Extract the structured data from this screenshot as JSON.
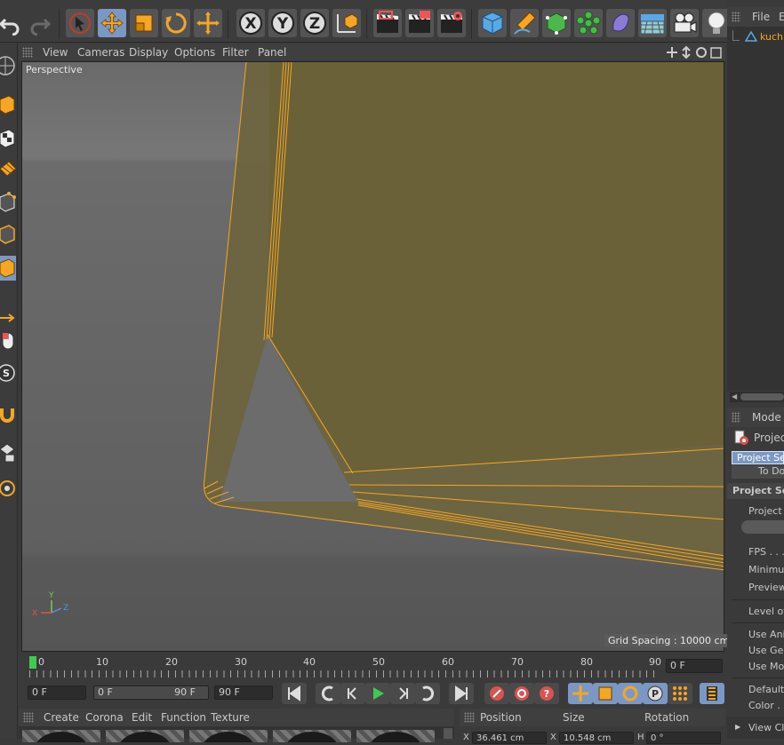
{
  "viewport": {
    "menu": [
      "View",
      "Cameras",
      "Display",
      "Options",
      "Filter",
      "Panel"
    ],
    "camera_label": "Perspective",
    "grid_spacing": "Grid Spacing : 10000 cm",
    "axis": {
      "x": "X",
      "y": "Y",
      "z": "Z"
    }
  },
  "toolbar": {
    "icons": [
      "undo-icon",
      "redo-icon",
      "select-icon",
      "move-icon",
      "scale-icon",
      "rotate-icon",
      "transform-icon",
      "x-axis-icon",
      "y-axis-icon",
      "z-axis-icon",
      "coordinate-system-icon",
      "render-view-icon",
      "render-picture-viewer-icon",
      "render-settings-icon",
      "cube-icon",
      "pen-icon",
      "subdivision-icon",
      "cloner-icon",
      "deformer-icon",
      "floor-icon",
      "camera-icon",
      "light-icon"
    ],
    "axis_labels": [
      "X",
      "Y",
      "Z"
    ]
  },
  "timeline": {
    "ticks": [
      "0",
      "10",
      "20",
      "30",
      "40",
      "50",
      "60",
      "70",
      "80",
      "90"
    ],
    "current_frame": "0 F",
    "start": "0 F",
    "range_start": "0 F",
    "range_end": "90 F",
    "end": "90 F"
  },
  "materials": {
    "menu": [
      "Create",
      "Corona",
      "Edit",
      "Function",
      "Texture"
    ]
  },
  "coordinates": {
    "headers": [
      "Position",
      "Size",
      "Rotation"
    ],
    "x_label": "X",
    "x_value": "36.461 cm",
    "size_label": "X",
    "size_value": "10.548 cm",
    "rot_label": "H",
    "rot_value": "0 °"
  },
  "object_manager": {
    "menu": [
      "File",
      "E"
    ],
    "object_name": "kuchn"
  },
  "attributes": {
    "mode_label": "Mode",
    "project_label": "Project",
    "tab_active": "Project Set",
    "tab_other": "To Do",
    "section": "Project Setti",
    "rows": [
      "Project",
      "FPS . . .",
      "Minimum",
      "Preview",
      "Level of",
      "Use Ani",
      "Use Ger",
      "Use Mo",
      "Default",
      "Color ."
    ],
    "footer": "View Cli"
  },
  "colors": {
    "accent": "#7b98c4",
    "wire": "#f5a623",
    "model_fill": "#6e6440"
  }
}
